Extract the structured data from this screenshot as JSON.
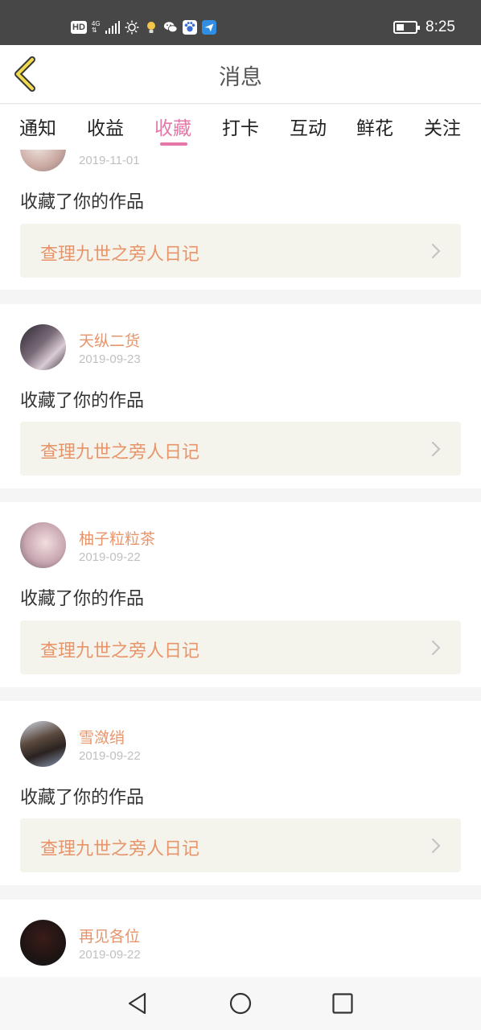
{
  "status_bar": {
    "hd": "HD",
    "network": "4G",
    "time": "8:25",
    "icons": [
      "signal-icon",
      "brightness-icon",
      "lightbulb-icon",
      "wechat-icon",
      "baidu-icon",
      "message-app-icon",
      "battery-icon"
    ]
  },
  "header": {
    "title": "消息",
    "back_icon": "back-chevron-icon"
  },
  "tabs": {
    "items": [
      {
        "label": "通知"
      },
      {
        "label": "收益"
      },
      {
        "label": "收藏"
      },
      {
        "label": "打卡"
      },
      {
        "label": "互动"
      },
      {
        "label": "鲜花"
      },
      {
        "label": "关注"
      }
    ],
    "active": "收藏"
  },
  "colors": {
    "accent": "#e576a8",
    "username": "#e7946a",
    "work_bg": "#f5f4ec",
    "statusbar": "#474747"
  },
  "messages": [
    {
      "user": "",
      "date": "2019-11-01",
      "action": "收藏了你的作品",
      "work": "查理九世之旁人日记"
    },
    {
      "user": "天纵二货",
      "date": "2019-09-23",
      "action": "收藏了你的作品",
      "work": "查理九世之旁人日记"
    },
    {
      "user": "柚子粒粒茶",
      "date": "2019-09-22",
      "action": "收藏了你的作品",
      "work": "查理九世之旁人日记"
    },
    {
      "user": "雪潋绡",
      "date": "2019-09-22",
      "action": "收藏了你的作品",
      "work": "查理九世之旁人日记"
    },
    {
      "user": "再见各位",
      "date": "2019-09-22",
      "action": "",
      "work": ""
    }
  ],
  "nav_bar": {
    "icons": [
      "back-triangle-icon",
      "home-circle-icon",
      "recents-square-icon"
    ]
  }
}
